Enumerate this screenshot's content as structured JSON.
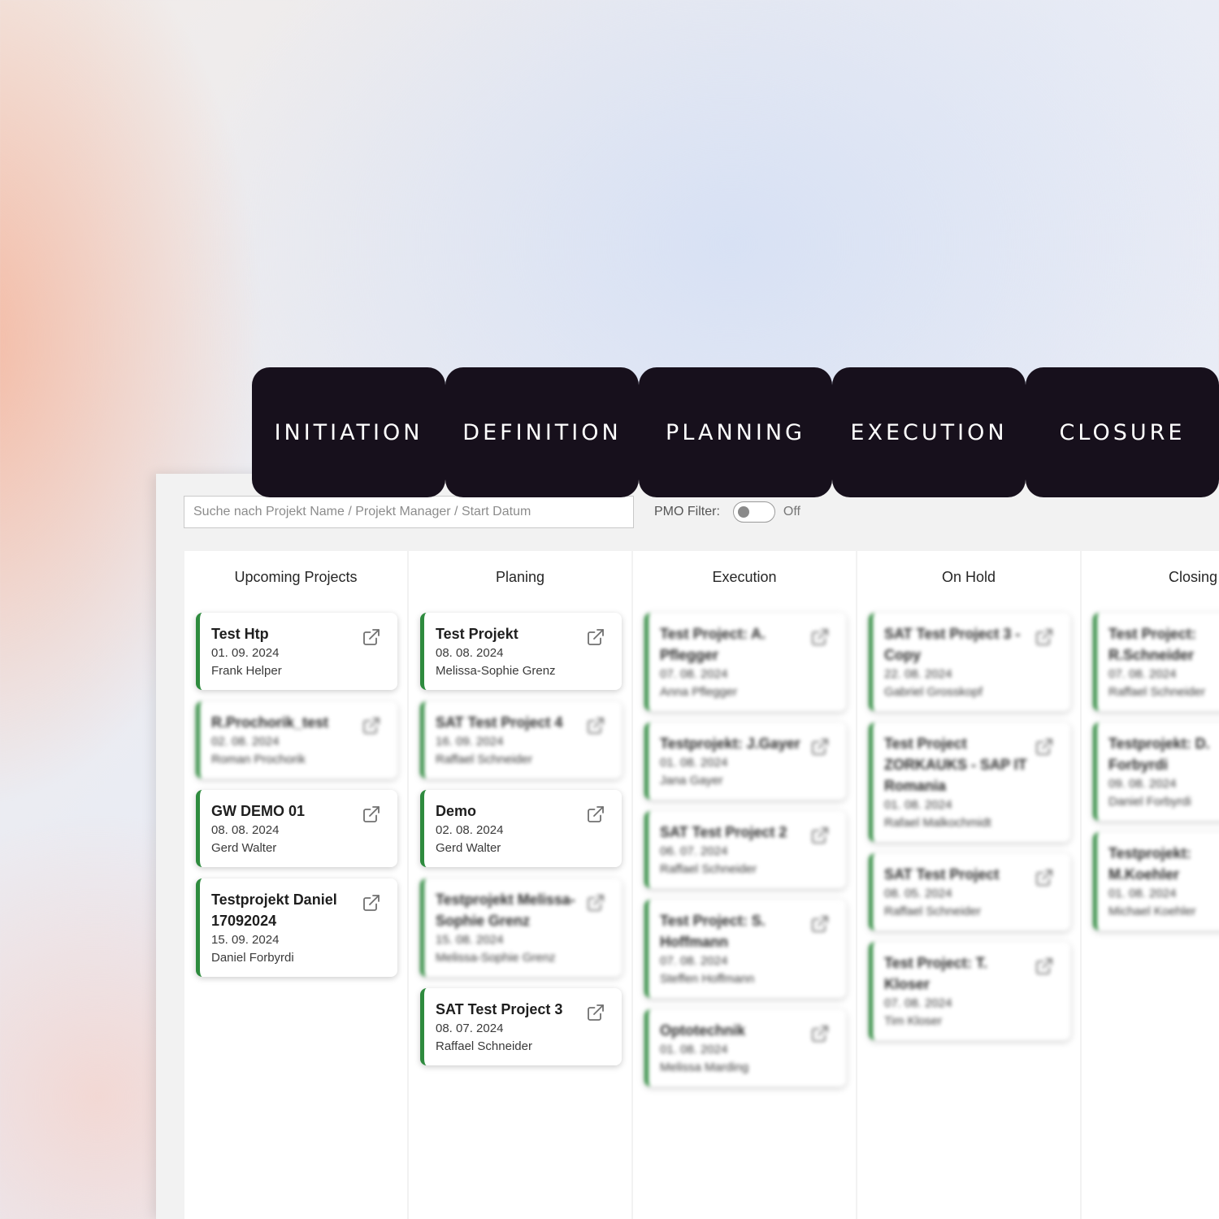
{
  "phases": [
    "INITIATION",
    "DEFINITION",
    "PLANNING",
    "EXECUTION",
    "CLOSURE"
  ],
  "toolbar": {
    "search_placeholder": "Suche nach Projekt Name / Projekt Manager / Start Datum",
    "pmo_label": "PMO Filter:",
    "pmo_state": "Off"
  },
  "icons": {
    "card_link": "external-link-icon"
  },
  "colors": {
    "card_accent": "#2e8b3e",
    "phase_tab": "#17101c"
  },
  "columns": [
    {
      "title": "Upcoming Projects",
      "cards": [
        {
          "title": "Test Htp",
          "date": "01. 09. 2024",
          "manager": "Frank Helper",
          "blurred": false
        },
        {
          "title": "R.Prochorik_test",
          "date": "02. 08. 2024",
          "manager": "Roman Prochorik",
          "blurred": true
        },
        {
          "title": "GW DEMO 01",
          "date": "08. 08. 2024",
          "manager": "Gerd Walter",
          "blurred": false
        },
        {
          "title": "Testprojekt Daniel 17092024",
          "date": "15. 09. 2024",
          "manager": "Daniel Forbyrdi",
          "blurred": false
        }
      ]
    },
    {
      "title": "Planing",
      "cards": [
        {
          "title": "Test Projekt",
          "date": "08. 08. 2024",
          "manager": "Melissa-Sophie Grenz",
          "blurred": false
        },
        {
          "title": "SAT Test Project 4",
          "date": "16. 09. 2024",
          "manager": "Raffael Schneider",
          "blurred": true
        },
        {
          "title": "Demo",
          "date": "02. 08. 2024",
          "manager": "Gerd Walter",
          "blurred": false
        },
        {
          "title": "Testprojekt Melissa-Sophie Grenz",
          "date": "15. 08. 2024",
          "manager": "Melissa-Sophie Grenz",
          "blurred": true
        },
        {
          "title": "SAT Test Project 3",
          "date": "08. 07. 2024",
          "manager": "Raffael Schneider",
          "blurred": false
        }
      ]
    },
    {
      "title": "Execution",
      "cards": [
        {
          "title": "Test Project: A. Pflegger",
          "date": "07. 08. 2024",
          "manager": "Anna Pflegger",
          "blurred": true
        },
        {
          "title": "Testprojekt: J.Gayer",
          "date": "01. 08. 2024",
          "manager": "Jana Gayer",
          "blurred": true
        },
        {
          "title": "SAT Test Project 2",
          "date": "06. 07. 2024",
          "manager": "Raffael Schneider",
          "blurred": true
        },
        {
          "title": "Test Project: S. Hoffmann",
          "date": "07. 08. 2024",
          "manager": "Steffen Hoffmann",
          "blurred": true
        },
        {
          "title": "Optotechnik",
          "date": "01. 08. 2024",
          "manager": "Melissa Marding",
          "blurred": true
        }
      ]
    },
    {
      "title": "On Hold",
      "cards": [
        {
          "title": "SAT Test Project 3 - Copy",
          "date": "22. 08. 2024",
          "manager": "Gabriel Grosskopf",
          "blurred": true
        },
        {
          "title": "Test Project ZORKAUKS - SAP IT Romania",
          "date": "01. 08. 2024",
          "manager": "Rafael Malkochmidt",
          "blurred": true
        },
        {
          "title": "SAT Test Project",
          "date": "08. 05. 2024",
          "manager": "Raffael Schneider",
          "blurred": true
        },
        {
          "title": "Test Project: T. Kloser",
          "date": "07. 08. 2024",
          "manager": "Tim Kloser",
          "blurred": true
        }
      ]
    },
    {
      "title": "Closing",
      "cards": [
        {
          "title": "Test Project: R.Schneider",
          "date": "07. 08. 2024",
          "manager": "Raffael Schneider",
          "blurred": true
        },
        {
          "title": "Testprojekt: D. Forbyrdi",
          "date": "09. 08. 2024",
          "manager": "Daniel Forbyrdi",
          "blurred": true
        },
        {
          "title": "Testprojekt: M.Koehler",
          "date": "01. 08. 2024",
          "manager": "Michael Koehler",
          "blurred": true
        }
      ]
    }
  ]
}
